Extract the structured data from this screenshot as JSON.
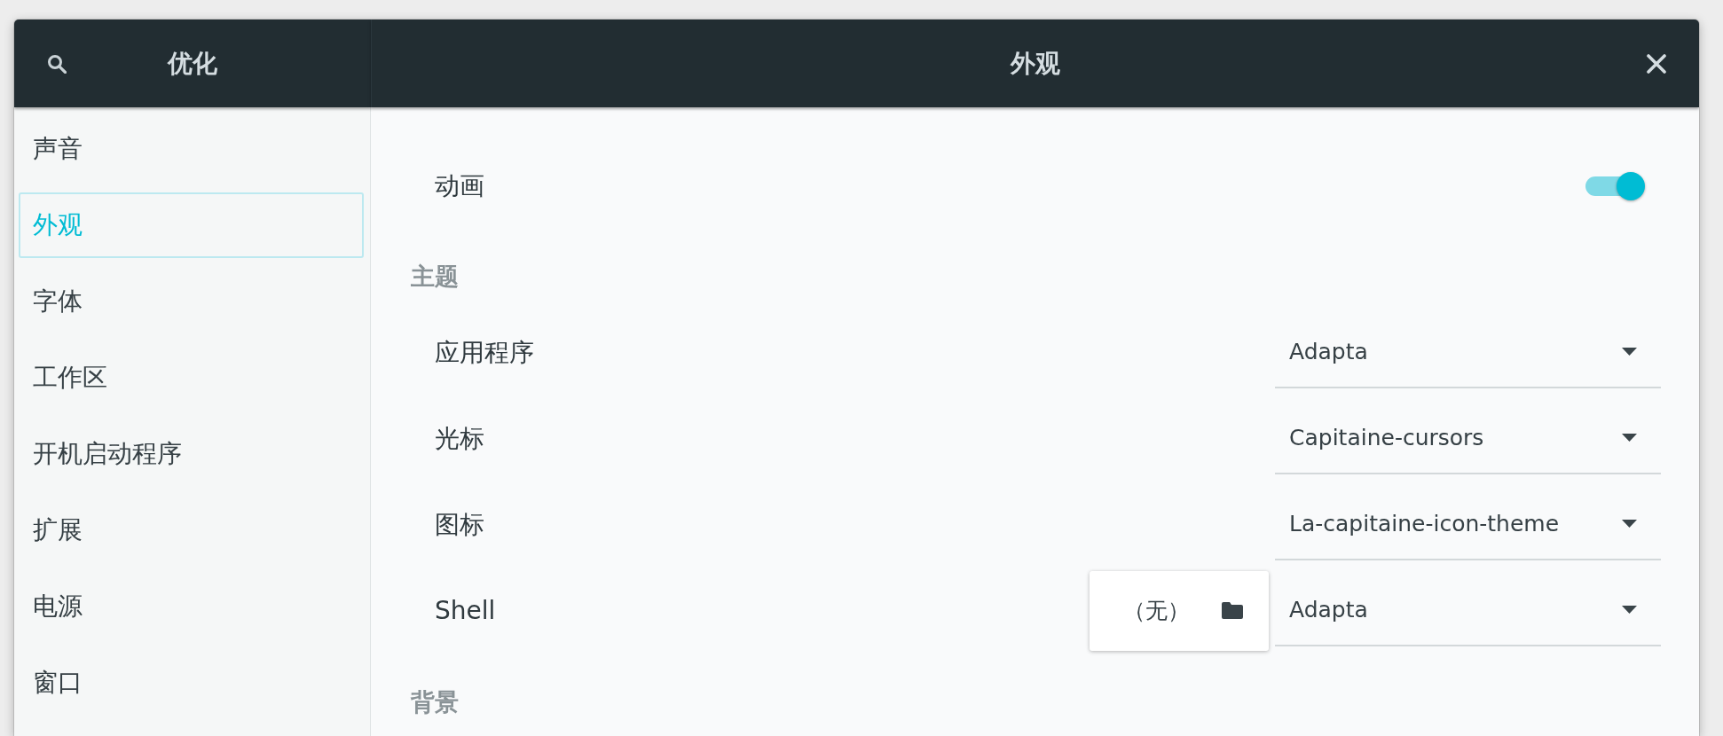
{
  "header": {
    "sidebar_title": "优化",
    "title": "外观"
  },
  "sidebar": {
    "items": [
      {
        "label": "声音",
        "selected": false
      },
      {
        "label": "外观",
        "selected": true
      },
      {
        "label": "字体",
        "selected": false
      },
      {
        "label": "工作区",
        "selected": false
      },
      {
        "label": "开机启动程序",
        "selected": false
      },
      {
        "label": "扩展",
        "selected": false
      },
      {
        "label": "电源",
        "selected": false
      },
      {
        "label": "窗口",
        "selected": false
      }
    ]
  },
  "content": {
    "rows": [
      {
        "kind": "switch",
        "label": "动画",
        "on": true
      },
      {
        "kind": "heading",
        "label": "主题"
      },
      {
        "kind": "dropdown",
        "label": "应用程序",
        "value": "Adapta"
      },
      {
        "kind": "dropdown",
        "label": "光标",
        "value": "Capitaine-cursors"
      },
      {
        "kind": "dropdown",
        "label": "图标",
        "value": "La-capitaine-icon-theme"
      },
      {
        "kind": "dropdown",
        "label": "Shell",
        "value": "Adapta",
        "file_chooser": {
          "value": "（无）"
        }
      },
      {
        "kind": "heading",
        "label": "背景"
      }
    ]
  }
}
